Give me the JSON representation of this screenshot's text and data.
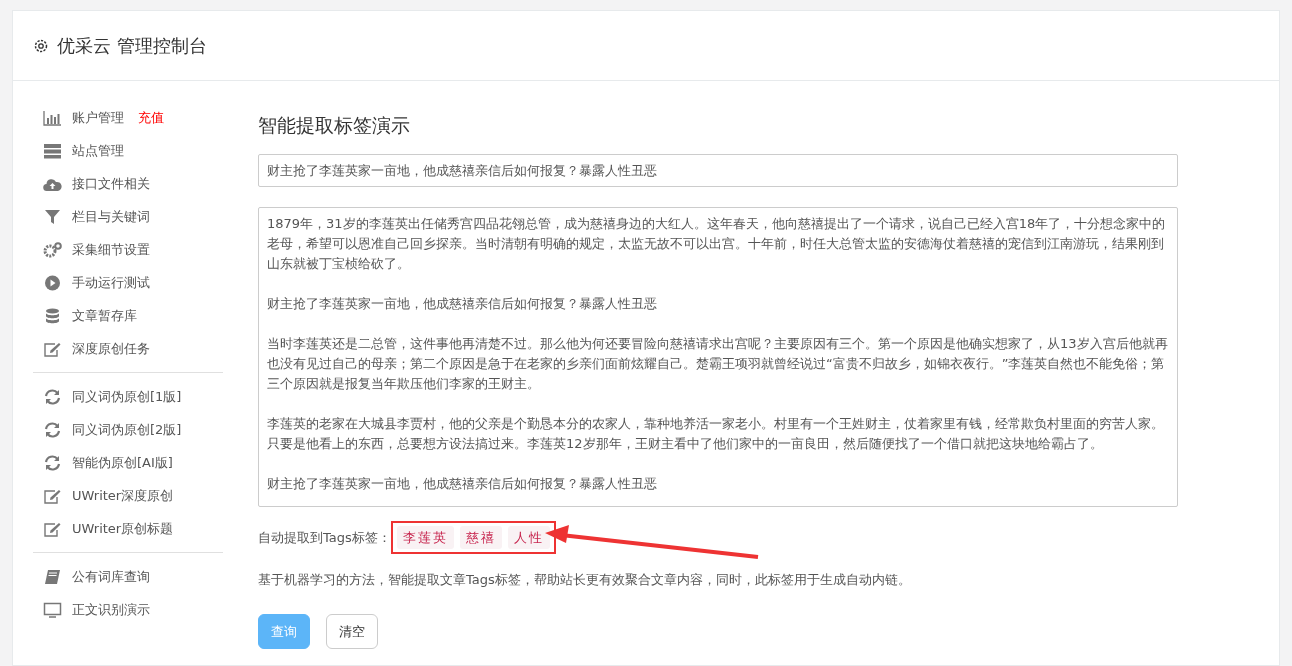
{
  "header": {
    "title": "优采云 管理控制台"
  },
  "sidebar": {
    "groups": [
      [
        {
          "kind": "chart",
          "label": "账户管理",
          "badge": "充值"
        },
        {
          "kind": "server",
          "label": "站点管理"
        },
        {
          "kind": "cloud",
          "label": "接口文件相关"
        },
        {
          "kind": "filter",
          "label": "栏目与关键词"
        },
        {
          "kind": "gears",
          "label": "采集细节设置"
        },
        {
          "kind": "play",
          "label": "手动运行测试"
        },
        {
          "kind": "database",
          "label": "文章暂存库"
        },
        {
          "kind": "edit",
          "label": "深度原创任务"
        }
      ],
      [
        {
          "kind": "refresh",
          "label": "同义词伪原创[1版]"
        },
        {
          "kind": "refresh",
          "label": "同义词伪原创[2版]"
        },
        {
          "kind": "refresh",
          "label": "智能伪原创[AI版]"
        },
        {
          "kind": "edit",
          "label": "UWriter深度原创"
        },
        {
          "kind": "edit",
          "label": "UWriter原创标题"
        }
      ],
      [
        {
          "kind": "book",
          "label": "公有词库查询"
        },
        {
          "kind": "monitor",
          "label": "正文识别演示"
        }
      ]
    ]
  },
  "main": {
    "heading": "智能提取标签演示",
    "title_field": {
      "value": "财主抢了李莲英家一亩地，他成慈禧亲信后如何报复？暴露人性丑恶"
    },
    "article_field": {
      "paragraphs": [
        "1879年，31岁的李莲英出任储秀宫四品花翎总管，成为慈禧身边的大红人。这年春天，他向慈禧提出了一个请求，说自己已经入宫18年了，十分想念家中的老母，希望可以恩准自己回乡探亲。当时清朝有明确的规定，太监无故不可以出宫。十年前，时任大总管太监的安德海仗着慈禧的宠信到江南游玩，结果刚到山东就被丁宝桢给砍了。",
        "财主抢了李莲英家一亩地，他成慈禧亲信后如何报复？暴露人性丑恶",
        "当时李莲英还是二总管，这件事他再清楚不过。那么他为何还要冒险向慈禧请求出宫呢？主要原因有三个。第一个原因是他确实想家了，从13岁入宫后他就再也没有见过自己的母亲；第二个原因是急于在老家的乡亲们面前炫耀自己。楚霸王项羽就曾经说过“富贵不归故乡，如锦衣夜行。”李莲英自然也不能免俗；第三个原因就是报复当年欺压他们李家的王财主。",
        "李莲英的老家在大城县李贾村，他的父亲是个勤恳本分的农家人，靠种地养活一家老小。村里有一个王姓财主，仗着家里有钱，经常欺负村里面的穷苦人家。只要是他看上的东西，总要想方设法搞过来。李莲英12岁那年，王财主看中了他们家中的一亩良田，然后随便找了一个借口就把这块地给霸占了。",
        "财主抢了李莲英家一亩地，他成慈禧亲信后如何报复？暴露人性丑恶"
      ]
    },
    "tags_label": "自动提取到Tags标签：",
    "tags": [
      "李莲英",
      "慈禧",
      "人性"
    ],
    "note": "基于机器学习的方法，智能提取文章Tags标签，帮助站长更有效聚合文章内容，同时，此标签用于生成自动内链。",
    "buttons": [
      {
        "kind": "primary",
        "label": "查询"
      },
      {
        "kind": "default",
        "label": "清空"
      }
    ]
  }
}
